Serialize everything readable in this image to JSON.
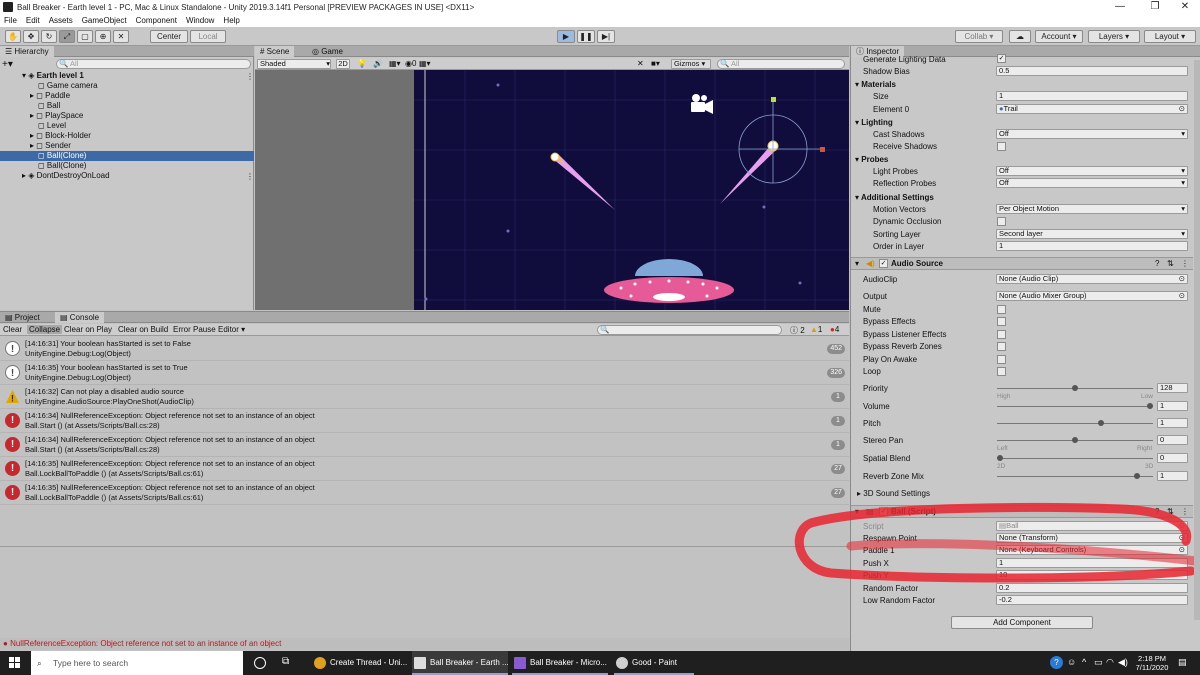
{
  "window": {
    "title": "Ball Breaker - Earth level 1 - PC, Mac & Linux Standalone - Unity 2019.3.14f1 Personal [PREVIEW PACKAGES IN USE] <DX11>"
  },
  "menu": [
    "File",
    "Edit",
    "Assets",
    "GameObject",
    "Component",
    "Window",
    "Help"
  ],
  "toolbar": {
    "center": "Center",
    "local": "Local",
    "collab": "Collab ▾",
    "account": "Account",
    "layers": "Layers",
    "layout": "Layout"
  },
  "hierarchy": {
    "tab": "Hierarchy",
    "search_placeholder": "All",
    "items": [
      "Earth level 1",
      "Game camera",
      "Paddle",
      "Ball",
      "PlaySpace",
      "Level",
      "Block-Holder",
      "Sender",
      "Ball(Clone)",
      "Ball(Clone)",
      "DontDestroyOnLoad"
    ]
  },
  "scene": {
    "tab_scene": "Scene",
    "tab_game": "Game",
    "shading": "Shaded",
    "mode2d": "2D",
    "layers_count": "0",
    "gizmos": "Gizmos",
    "search_placeholder": "All"
  },
  "console": {
    "tab_project": "Project",
    "tab_console": "Console",
    "buttons": [
      "Clear",
      "Collapse",
      "Clear on Play",
      "Clear on Build",
      "Error Pause",
      "Editor"
    ],
    "count_info": "2",
    "count_warn": "1",
    "count_err": "4",
    "logs": [
      {
        "type": "info",
        "line1": "[14:16:31] Your boolean hasStarted is set to False",
        "line2": "UnityEngine.Debug:Log(Object)",
        "count": "452"
      },
      {
        "type": "info",
        "line1": "[14:16:35] Your boolean hasStarted is set to True",
        "line2": "UnityEngine.Debug:Log(Object)",
        "count": "326"
      },
      {
        "type": "warn",
        "line1": "[14:16:32] Can not play a disabled audio source",
        "line2": "UnityEngine.AudioSource:PlayOneShot(AudioClip)",
        "count": "1"
      },
      {
        "type": "err",
        "line1": "[14:16:34] NullReferenceException: Object reference not set to an instance of an object",
        "line2": "Ball.Start () (at Assets/Scripts/Ball.cs:28)",
        "count": "1"
      },
      {
        "type": "err",
        "line1": "[14:16:34] NullReferenceException: Object reference not set to an instance of an object",
        "line2": "Ball.Start () (at Assets/Scripts/Ball.cs:28)",
        "count": "1"
      },
      {
        "type": "err",
        "line1": "[14:16:35] NullReferenceException: Object reference not set to an instance of an object",
        "line2": "Ball.LockBallToPaddle () (at Assets/Scripts/Ball.cs:61)",
        "count": "27"
      },
      {
        "type": "err",
        "line1": "[14:16:35] NullReferenceException: Object reference not set to an instance of an object",
        "line2": "Ball.LockBallToPaddle () (at Assets/Scripts/Ball.cs:61)",
        "count": "27"
      }
    ]
  },
  "status": {
    "message": "NullReferenceException: Object reference not set to an instance of an object"
  },
  "inspector": {
    "tab": "Inspector",
    "trail": {
      "gen_lighting": "Generate Lighting Data",
      "shadow_bias": "Shadow Bias",
      "shadow_bias_val": "0.5",
      "materials": "Materials",
      "size": "Size",
      "size_val": "1",
      "element0": "Element 0",
      "element0_val": "Trail",
      "lighting": "Lighting",
      "cast_shadows": "Cast Shadows",
      "cast_shadows_val": "Off",
      "receive_shadows": "Receive Shadows",
      "probes": "Probes",
      "light_probes": "Light Probes",
      "light_probes_val": "Off",
      "refl_probes": "Reflection Probes",
      "refl_probes_val": "Off",
      "additional": "Additional Settings",
      "motion_vectors": "Motion Vectors",
      "motion_vectors_val": "Per Object Motion",
      "dyn_occ": "Dynamic Occlusion",
      "sorting_layer": "Sorting Layer",
      "sorting_layer_val": "Second layer",
      "order_layer": "Order in Layer",
      "order_layer_val": "1"
    },
    "audio": {
      "title": "Audio Source",
      "clip": "AudioClip",
      "clip_val": "None (Audio Clip)",
      "output": "Output",
      "output_val": "None (Audio Mixer Group)",
      "mute": "Mute",
      "bypass_effects": "Bypass Effects",
      "bypass_listener": "Bypass Listener Effects",
      "bypass_reverb": "Bypass Reverb Zones",
      "play_awake": "Play On Awake",
      "loop": "Loop",
      "priority": "Priority",
      "priority_val": "128",
      "priority_fill": 0.5,
      "high": "High",
      "low": "Low",
      "volume": "Volume",
      "volume_val": "1",
      "volume_fill": 1,
      "pitch": "Pitch",
      "pitch_val": "1",
      "pitch_fill": 0.67,
      "stereo": "Stereo Pan",
      "stereo_val": "0",
      "stereo_fill": 0.5,
      "left": "Left",
      "right": "Right",
      "spatial": "Spatial Blend",
      "spatial_val": "0",
      "spatial_fill": 0,
      "s2d": "2D",
      "s3d": "3D",
      "reverb_mix": "Reverb Zone Mix",
      "reverb_mix_val": "1",
      "reverb_fill": 0.91,
      "sound3d": "3D Sound Settings"
    },
    "ball": {
      "title": "Ball (Script)",
      "script": "Script",
      "script_val": "Ball",
      "respawn": "Respawn Point",
      "respawn_val": "None (Transform)",
      "paddle": "Paddle 1",
      "paddle_val": "None (Keyboard Controls)",
      "pushx": "Push X",
      "pushx_val": "1",
      "pushy": "Push Y",
      "pushy_val": "10",
      "random": "Random Factor",
      "random_val": "0.2",
      "lowrandom": "Low Random Factor",
      "lowrandom_val": "-0.2"
    },
    "add_component": "Add Component"
  },
  "taskbar": {
    "search_placeholder": "Type here to search",
    "apps": [
      "Create Thread - Uni...",
      "Ball Breaker - Earth ...",
      "Ball Breaker - Micro...",
      "Good - Paint"
    ],
    "time": "2:18 PM",
    "date": "7/11/2020"
  },
  "colors": {
    "scene_bg": "#100c3c",
    "selection": "#3d6aa6",
    "error": "#c7272e",
    "highlight": "#e82630",
    "ufo_dome": "#7fa8d8",
    "ufo_body": "#e75a98"
  }
}
